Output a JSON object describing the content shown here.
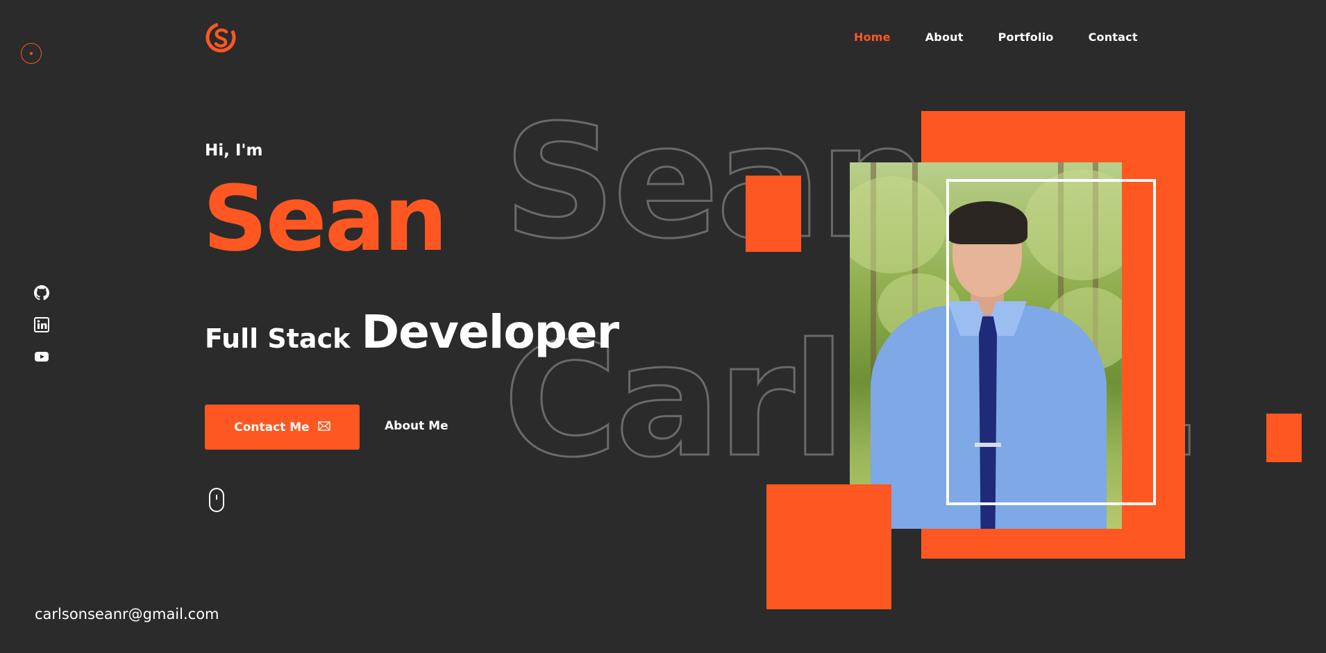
{
  "colors": {
    "background": "#2b2b2b",
    "accent": "#ff5722",
    "text": "#ffffff"
  },
  "logo": {
    "icon": "cs-logo-icon"
  },
  "nav": {
    "items": [
      {
        "label": "Home",
        "active": true
      },
      {
        "label": "About",
        "active": false
      },
      {
        "label": "Portfolio",
        "active": false
      },
      {
        "label": "Contact",
        "active": false
      }
    ]
  },
  "hero": {
    "greeting": "Hi, I'm",
    "name": "Sean",
    "role_small": "Full Stack",
    "role_big": "Developer",
    "contact_button": "Contact Me",
    "contact_icon": "mail-icon",
    "about_link": "About Me",
    "background_outline_line1": "Sean",
    "background_outline_line2": "Carlson."
  },
  "social": [
    {
      "icon": "github-icon"
    },
    {
      "icon": "linkedin-icon"
    },
    {
      "icon": "youtube-icon"
    }
  ],
  "footer": {
    "email": "carlsonseanr@gmail.com"
  }
}
